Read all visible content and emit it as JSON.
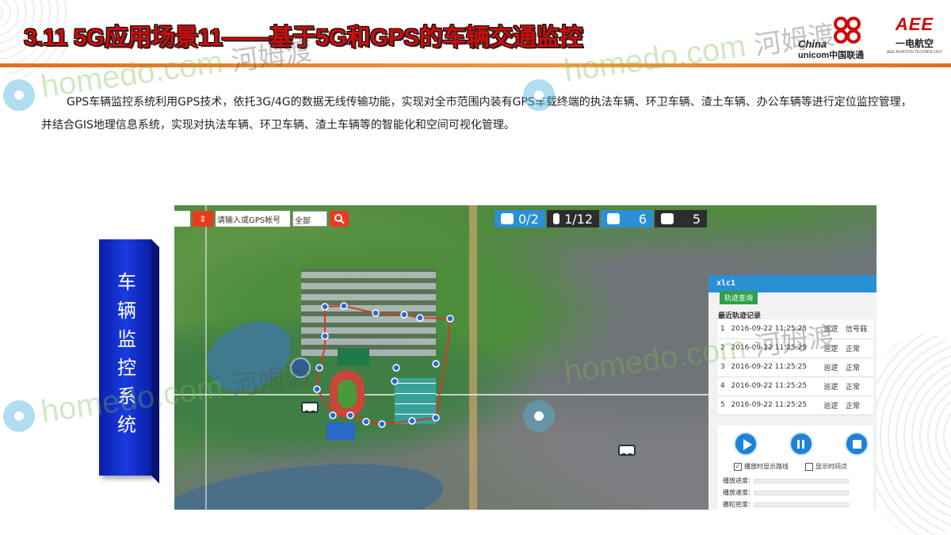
{
  "header": {
    "title": "3.11 5G应用场景11——基于5G和GPS的车辆交通监控",
    "logo_unicom": {
      "china": "China",
      "unicom": "unicom中国联通"
    },
    "logo_aee": {
      "mark": "AEE",
      "cn": "一电航空",
      "en": "AEE AVIATION TECHNOLOGY"
    },
    "accent_color": "#d10a0a",
    "line_color": "#e36d1c"
  },
  "paragraph": "GPS车辆监控系统利用GPS技术，依托3G/4G的数据无线传输功能，实现对全市范围内装有GPS车载终端的执法车辆、环卫车辆、渣土车辆、办公车辆等进行定位监控管理，并结合GIS地理信息系统，实现对执法车辆、环卫车辆、渣土车辆等的智能化和空间可视化管理。",
  "side_label": "车辆监控系统",
  "map": {
    "search_placeholder": "请输入或GPS帐号",
    "select_value": "全部",
    "stats": [
      {
        "icon": "truck-icon",
        "value": "0/2",
        "color": "#2b8fd6"
      },
      {
        "icon": "car-icon",
        "value": "1/12",
        "color": "#2d2d2d"
      },
      {
        "icon": "camera-icon",
        "value": "6",
        "color": "#2b8fd6"
      },
      {
        "icon": "check-icon",
        "value": "5",
        "color": "#2d2d2d"
      }
    ],
    "panel": {
      "account": "xlc1",
      "track_button": "轨迹查询",
      "section_title": "最近轨迹记录",
      "rows": [
        {
          "no": "1",
          "time": "2016-09-22 11:25:25",
          "action": "巡逻",
          "status": "信号弱"
        },
        {
          "no": "2",
          "time": "2016-09-22 11:25:25",
          "action": "巡逻",
          "status": "正常"
        },
        {
          "no": "3",
          "time": "2016-09-22 11:25:25",
          "action": "巡逻",
          "status": "正常"
        },
        {
          "no": "4",
          "time": "2016-09-22 11:25:25",
          "action": "巡逻",
          "status": "正常"
        },
        {
          "no": "5",
          "time": "2016-09-22 11:25:25",
          "action": "巡逻",
          "status": "正常"
        }
      ],
      "checkbox_route": "播放时显示路线",
      "checkbox_time": "显示时间点",
      "progress_label": "播放进度:",
      "speed_label": "播放速度:",
      "density_label": "撒粒密度:"
    }
  },
  "watermark": {
    "text": "homedo.com",
    "cn": "河姆渡"
  }
}
